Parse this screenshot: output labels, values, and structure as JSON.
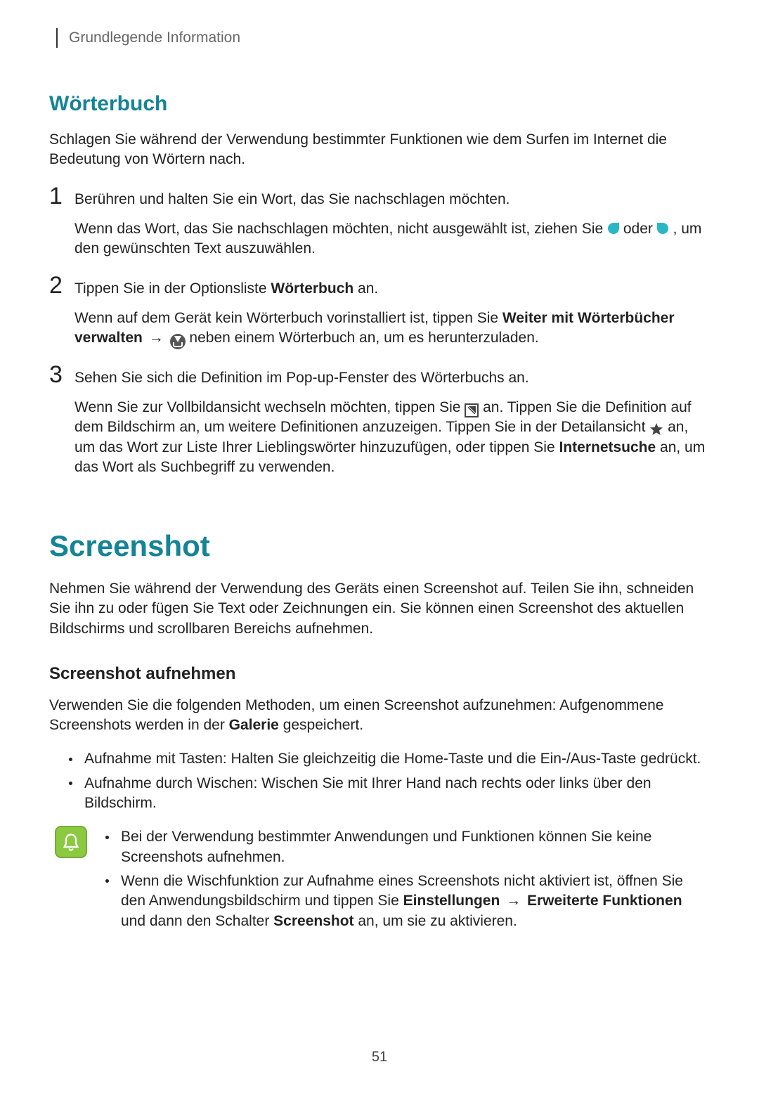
{
  "running_header": "Grundlegende Information",
  "dict": {
    "heading": "Wörterbuch",
    "intro": "Schlagen Sie während der Verwendung bestimmter Funktionen wie dem Surfen im Internet die Bedeutung von Wörtern nach.",
    "step1": {
      "lead": "Berühren und halten Sie ein Wort, das Sie nachschlagen möchten.",
      "detail_pre": "Wenn das Wort, das Sie nachschlagen möchten, nicht ausgewählt ist, ziehen Sie ",
      "detail_mid": " oder ",
      "detail_post": ", um den gewünschten Text auszuwählen."
    },
    "step2": {
      "lead_pre": "Tippen Sie in der Optionsliste ",
      "lead_bold": "Wörterbuch",
      "lead_post": " an.",
      "detail_pre": "Wenn auf dem Gerät kein Wörterbuch vorinstalliert ist, tippen Sie ",
      "detail_bold1": "Weiter mit Wörterbücher verwalten",
      "arrow": "→",
      "detail_post": " neben einem Wörterbuch an, um es herunterzuladen."
    },
    "step3": {
      "lead": "Sehen Sie sich die Definition im Pop-up-Fenster des Wörterbuchs an.",
      "d_a": "Wenn Sie zur Vollbildansicht wechseln möchten, tippen Sie ",
      "d_b": " an. Tippen Sie die Definition auf dem Bildschirm an, um weitere Definitionen anzuzeigen. Tippen Sie in der Detailansicht ",
      "d_c": " an, um das Wort zur Liste Ihrer Lieblingswörter hinzuzufügen, oder tippen Sie ",
      "d_bold": "Internetsuche",
      "d_d": " an, um das Wort als Suchbegriff zu verwenden."
    }
  },
  "shot": {
    "heading": "Screenshot",
    "intro": "Nehmen Sie während der Verwendung des Geräts einen Screenshot auf. Teilen Sie ihn, schneiden Sie ihn zu oder fügen Sie Text oder Zeichnungen ein. Sie können einen Screenshot des aktuellen Bildschirms und scrollbaren Bereichs aufnehmen.",
    "sub_heading": "Screenshot aufnehmen",
    "para_pre": "Verwenden Sie die folgenden Methoden, um einen Screenshot aufzunehmen: Aufgenommene Screenshots werden in der ",
    "para_bold": "Galerie",
    "para_post": " gespeichert.",
    "bullets": [
      "Aufnahme mit Tasten: Halten Sie gleichzeitig die Home-Taste und die Ein-/Aus-Taste gedrückt.",
      "Aufnahme durch Wischen: Wischen Sie mit Ihrer Hand nach rechts oder links über den Bildschirm."
    ],
    "note1": "Bei der Verwendung bestimmter Anwendungen und Funktionen können Sie keine Screenshots aufnehmen.",
    "note2_a": "Wenn die Wischfunktion zur Aufnahme eines Screenshots nicht aktiviert ist, öffnen Sie den Anwendungsbildschirm und tippen Sie ",
    "note2_b1": "Einstellungen",
    "arrow": "→",
    "note2_b2": "Erweiterte Funktionen",
    "note2_c": " und dann den Schalter ",
    "note2_b3": "Screenshot",
    "note2_d": " an, um sie zu aktivieren."
  },
  "page_number": "51"
}
